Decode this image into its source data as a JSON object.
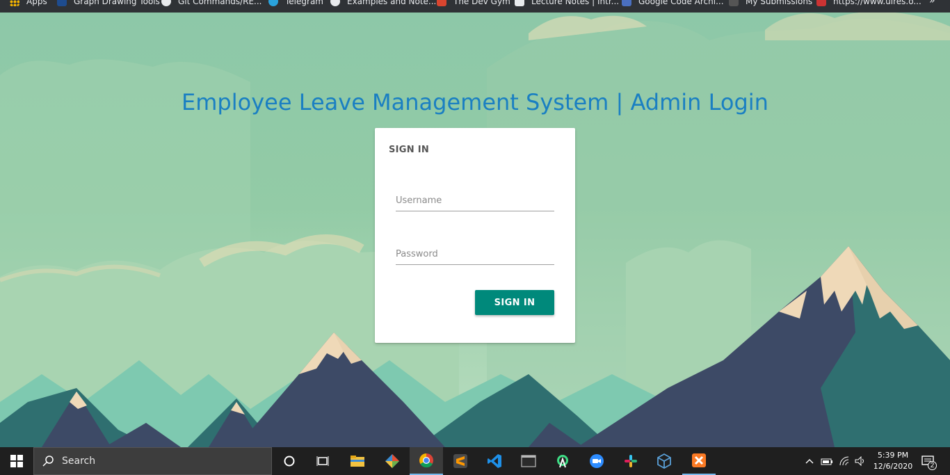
{
  "bookmarks": [
    {
      "label": "Apps",
      "icon": "apps-grid-icon"
    },
    {
      "label": "Graph Drawing Tools",
      "icon": "bookmark-favicon"
    },
    {
      "label": "Git Commands/RE...",
      "icon": "github-icon"
    },
    {
      "label": "Telegram",
      "icon": "telegram-icon"
    },
    {
      "label": "Examples and Note...",
      "icon": "bookmark-favicon"
    },
    {
      "label": "The Dev Gym",
      "icon": "bookmark-favicon"
    },
    {
      "label": "Lecture Notes | Intr...",
      "icon": "ocw-icon"
    },
    {
      "label": "Google Code Archi...",
      "icon": "bookmark-favicon"
    },
    {
      "label": "My Submissions",
      "icon": "bookmark-favicon"
    },
    {
      "label": "https://www.ulres.o...",
      "icon": "bookmark-favicon"
    }
  ],
  "page": {
    "title": "Employee Leave Management System | Admin Login"
  },
  "login": {
    "heading": "SIGN IN",
    "username_placeholder": "Username",
    "password_placeholder": "Password",
    "submit_label": "SIGN IN"
  },
  "taskbar": {
    "search_placeholder": "Search",
    "time": "5:39 PM",
    "date": "12/6/2020",
    "notification_count": "2"
  },
  "colors": {
    "title": "#1a7fc2",
    "button": "#00897b",
    "sky": "#8dc8a8",
    "mountain_dark": "#3d4a66",
    "mountain_teal": "#2f6f70",
    "snow": "#efd9b8"
  }
}
